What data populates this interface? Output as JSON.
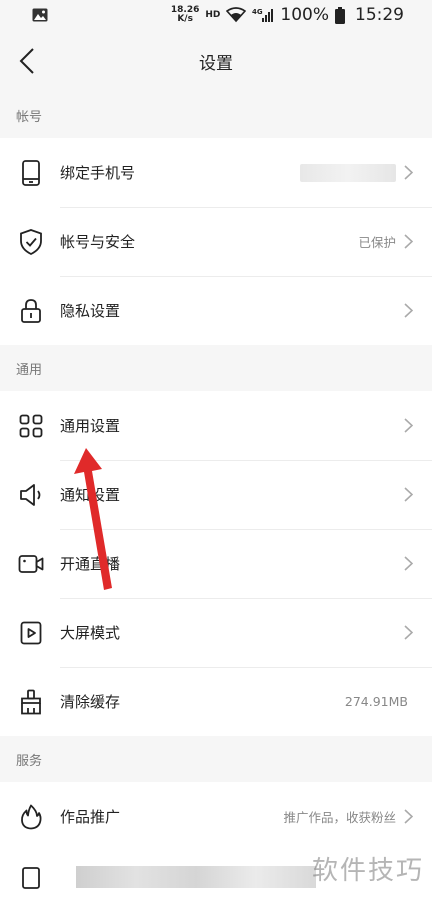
{
  "status_bar": {
    "net_speed_value": "18.26",
    "net_speed_unit": "K/s",
    "hd": "HD",
    "signal": "4G",
    "battery": "100%",
    "time": "15:29"
  },
  "nav": {
    "title": "设置"
  },
  "sections": {
    "account": {
      "header": "帐号",
      "items": [
        {
          "label": "绑定手机号",
          "value": "",
          "icon": "phone-icon"
        },
        {
          "label": "帐号与安全",
          "value": "已保护",
          "icon": "shield-check-icon"
        },
        {
          "label": "隐私设置",
          "value": "",
          "icon": "lock-icon"
        }
      ]
    },
    "general": {
      "header": "通用",
      "items": [
        {
          "label": "通用设置",
          "value": "",
          "icon": "grid-icon"
        },
        {
          "label": "通知设置",
          "value": "",
          "icon": "speaker-icon"
        },
        {
          "label": "开通直播",
          "value": "",
          "icon": "video-camera-icon"
        },
        {
          "label": "大屏模式",
          "value": "",
          "icon": "play-screen-icon"
        },
        {
          "label": "清除缓存",
          "value": "274.91MB",
          "icon": "brush-icon"
        }
      ]
    },
    "services": {
      "header": "服务",
      "items": [
        {
          "label": "作品推广",
          "value": "推广作品，收获粉丝",
          "icon": "flame-icon"
        }
      ]
    }
  },
  "watermark": "软件技巧",
  "colors": {
    "background": "#f6f6f6",
    "card": "#ffffff",
    "annotation_arrow": "#e02a2a"
  }
}
